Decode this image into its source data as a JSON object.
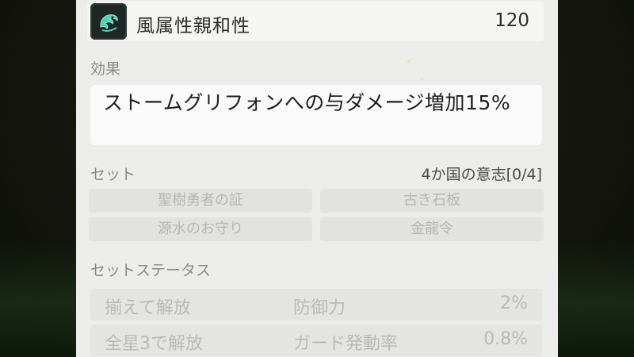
{
  "header": {
    "icon": "wind-element-icon",
    "name": "風属性親和性",
    "value": "120",
    "icon_color": "#4fd1b5"
  },
  "effect": {
    "label": "効果",
    "text": "ストームグリフォンへの与ダメージ増加15%"
  },
  "set": {
    "label": "セット",
    "name": "4か国の意志[0/4]",
    "items": [
      "聖樹勇者の証",
      "古き石板",
      "源水のお守り",
      "金龍令"
    ]
  },
  "set_status": {
    "label": "セットステータス",
    "rows": [
      {
        "condition": "揃えて解放",
        "stat": "防御力",
        "value": "2%"
      },
      {
        "condition": "全星3で解放",
        "stat": "ガード発動率",
        "value": "0.8%"
      }
    ]
  }
}
